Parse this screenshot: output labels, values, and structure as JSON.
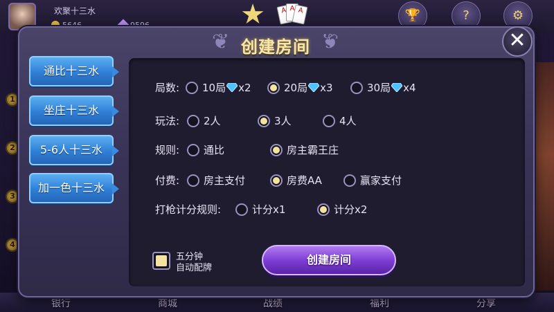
{
  "lobby": {
    "nickname": "欢聚十三水",
    "coins": "5646",
    "gems": "9596",
    "top_icons": [
      {
        "name": "activity",
        "label": "活动",
        "icon": "trophy-icon"
      },
      {
        "name": "help",
        "label": "帮助",
        "icon": "help-icon"
      },
      {
        "name": "settings",
        "label": "设置",
        "icon": "gear-icon"
      }
    ],
    "rank_numbers": [
      "1",
      "2",
      "3",
      "4"
    ],
    "bottom_nav": [
      "银行",
      "商城",
      "战绩",
      "福利",
      "分享"
    ],
    "logo_cards": [
      "A",
      "A",
      "A"
    ]
  },
  "dialog": {
    "title": "创建房间",
    "close_symbol": "✕",
    "tabs": [
      "通比十三水",
      "坐庄十三水",
      "5-6人十三水",
      "加一色十三水"
    ],
    "rows": {
      "rounds": {
        "label": "局数:",
        "options": [
          {
            "text": "10局",
            "cost": "x2",
            "selected": false
          },
          {
            "text": "20局",
            "cost": "x3",
            "selected": true
          },
          {
            "text": "30局",
            "cost": "x4",
            "selected": false
          }
        ]
      },
      "players": {
        "label": "玩法:",
        "options": [
          {
            "text": "2人",
            "selected": false
          },
          {
            "text": "3人",
            "selected": true
          },
          {
            "text": "4人",
            "selected": false
          }
        ]
      },
      "rule": {
        "label": "规则:",
        "options": [
          {
            "text": "通比",
            "selected": false
          },
          {
            "text": "房主霸王庄",
            "selected": true
          }
        ]
      },
      "payment": {
        "label": "付费:",
        "options": [
          {
            "text": "房主支付",
            "selected": false
          },
          {
            "text": "房费AA",
            "selected": true
          },
          {
            "text": "赢家支付",
            "selected": false
          }
        ]
      },
      "shoot": {
        "label": "打枪计分规则:",
        "options": [
          {
            "text": "计分x1",
            "selected": false
          },
          {
            "text": "计分x2",
            "selected": true
          }
        ]
      }
    },
    "auto_deal": {
      "line1": "五分钟",
      "line2": "自动配牌",
      "checked": true
    },
    "create_button": "创建房间"
  },
  "colors": {
    "tab_blue": "#2f7fd6",
    "create_purple": "#7e3fd6",
    "radio_selected": "#f3e2a0",
    "title_gold": "#f6e6b0"
  }
}
